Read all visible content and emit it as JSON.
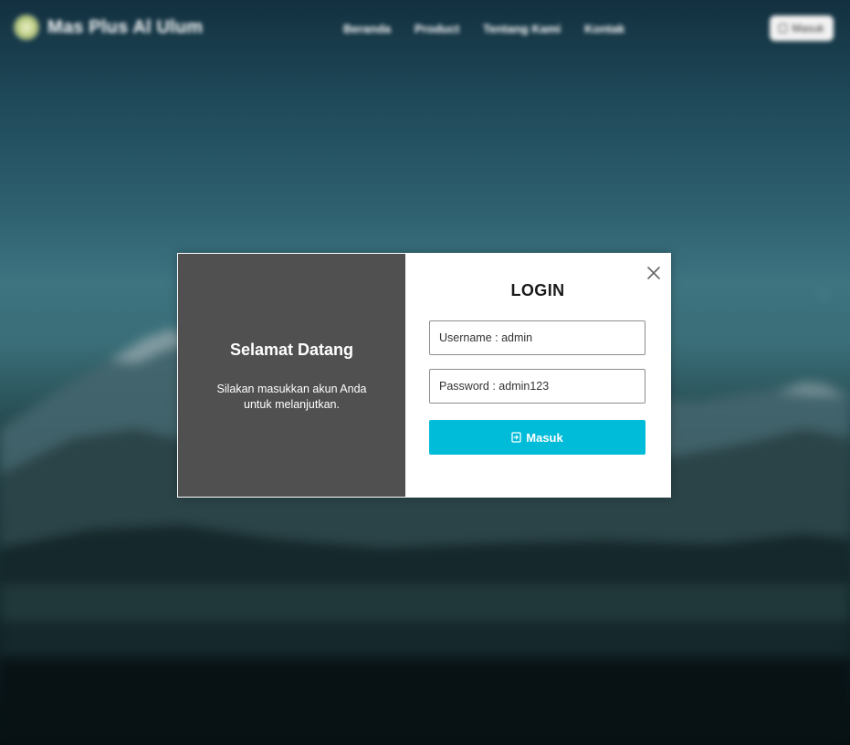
{
  "navbar": {
    "brand_name": "Mas Plus Al Ulum",
    "logo_icon": "school-logo-icon",
    "links": [
      "Beranda",
      "Product",
      "Tentang Kami",
      "Kontak"
    ],
    "login_label": "Masuk",
    "login_icon": "login-icon"
  },
  "modal": {
    "welcome_title": "Selamat Datang",
    "welcome_text": "Silakan masukkan akun Anda untuk melanjutkan.",
    "close_icon": "close-icon",
    "login_title": "LOGIN",
    "username_placeholder": "Username : admin",
    "password_placeholder": "Password : admin123",
    "submit_label": "Masuk",
    "submit_icon": "login-icon"
  },
  "colors": {
    "left_panel": "#505050",
    "accent": "#00bcd8",
    "background_top": "#13303f",
    "background_bottom": "#060f13"
  }
}
